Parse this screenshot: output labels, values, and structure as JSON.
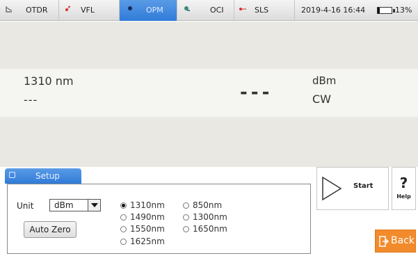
{
  "tabs": [
    {
      "label": "OTDR",
      "icon": "otdr-trace-icon"
    },
    {
      "label": "VFL",
      "icon": "vfl-laser-icon"
    },
    {
      "label": "OPM",
      "icon": "opm-dot-icon",
      "active": true
    },
    {
      "label": "OCI",
      "icon": "oci-probe-icon"
    },
    {
      "label": "SLS",
      "icon": "sls-source-icon"
    }
  ],
  "status": {
    "datetime": "2019-4-16 16:44",
    "battery_percent": "13%",
    "battery_level": 0.13
  },
  "measurement": {
    "wavelength": "1310 nm",
    "secondary_value": "---",
    "main_value": "---",
    "unit": "dBm",
    "mode": "CW"
  },
  "setup": {
    "tab_label": "Setup",
    "unit_label": "Unit",
    "unit_value": "dBm",
    "auto_zero_label": "Auto Zero",
    "wavelength_options": [
      {
        "label": "1310nm",
        "selected": true
      },
      {
        "label": "1490nm",
        "selected": false
      },
      {
        "label": "1550nm",
        "selected": false
      },
      {
        "label": "1625nm",
        "selected": false
      },
      {
        "label": "850nm",
        "selected": false
      },
      {
        "label": "1300nm",
        "selected": false
      },
      {
        "label": "1650nm",
        "selected": false
      }
    ]
  },
  "actions": {
    "start_label": "Start",
    "help_symbol": "?",
    "help_label": "Help",
    "back_label": "Back"
  },
  "colors": {
    "active_tab": "#3a85dc",
    "back_button": "#f28b2c",
    "panel_band": "#e9e8e2"
  }
}
